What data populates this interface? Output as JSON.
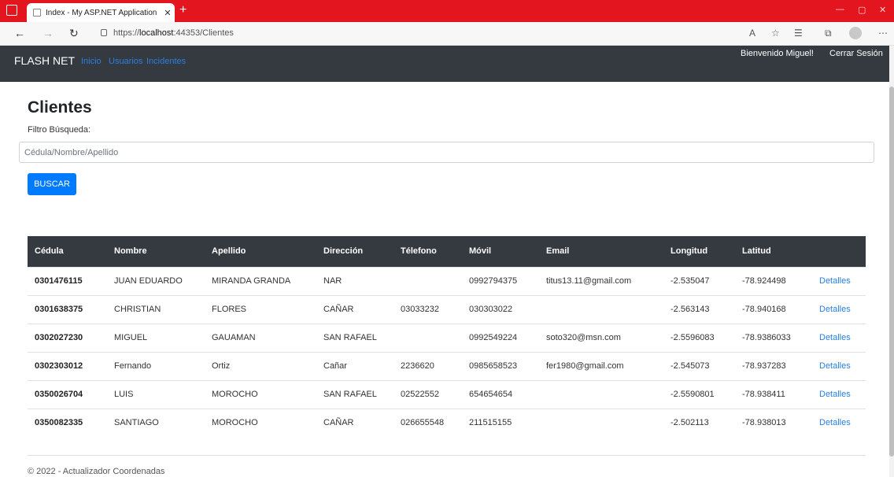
{
  "browser": {
    "tab_title": "Index - My ASP.NET Application",
    "tab_close": "✕",
    "new_tab": "+",
    "url_prefix": "https://",
    "url_host": "localhost",
    "url_rest": ":44353/Clientes"
  },
  "navbar": {
    "brand": "FLASH NET",
    "links": [
      "Inicio",
      "Usuarios",
      "Incidentes"
    ],
    "welcome": "Bienvenido Miguel!",
    "logout": "Cerrar Sesión"
  },
  "main": {
    "title": "Clientes",
    "filter_label": "Filtro Búsqueda:",
    "search_placeholder": "Cédula/Nombre/Apellido",
    "search_button": "BUSCAR"
  },
  "table": {
    "headers": [
      "Cédula",
      "Nombre",
      "Apellido",
      "Dirección",
      "Télefono",
      "Móvil",
      "Email",
      "Longitud",
      "Latitud",
      ""
    ],
    "detail_label": "Detalles",
    "rows": [
      [
        "0301476115",
        "JUAN EDUARDO",
        "MIRANDA GRANDA",
        "NAR",
        "",
        "0992794375",
        "titus13.11@gmail.com",
        "-2.535047",
        "-78.924498"
      ],
      [
        "0301638375",
        "CHRISTIAN",
        "FLORES",
        "CAÑAR",
        "03033232",
        "030303022",
        "",
        "-2.563143",
        "-78.940168"
      ],
      [
        "0302027230",
        "MIGUEL",
        "GAUAMAN",
        "SAN RAFAEL",
        "",
        "0992549224",
        "soto320@msn.com",
        "-2.5596083",
        "-78.9386033"
      ],
      [
        "0302303012",
        "Fernando",
        "Ortiz",
        "Cañar",
        "2236620",
        "0985658523",
        "fer1980@gmail.com",
        "-2.545073",
        "-78.937283"
      ],
      [
        "0350026704",
        "LUIS",
        "MOROCHO",
        "SAN RAFAEL",
        "02522552",
        "654654654",
        "",
        "-2.5590801",
        "-78.938411"
      ],
      [
        "0350082335",
        "SANTIAGO",
        "MOROCHO",
        "CAÑAR",
        "026655548",
        "211515155",
        "",
        "-2.502113",
        "-78.938013"
      ]
    ]
  },
  "footer": {
    "text": "© 2022 - Actualizador Coordenadas"
  },
  "colors": {
    "browser_bar": "#e3161f",
    "navbar": "#343a40",
    "link": "#2a7fe0",
    "button": "#007bff"
  }
}
